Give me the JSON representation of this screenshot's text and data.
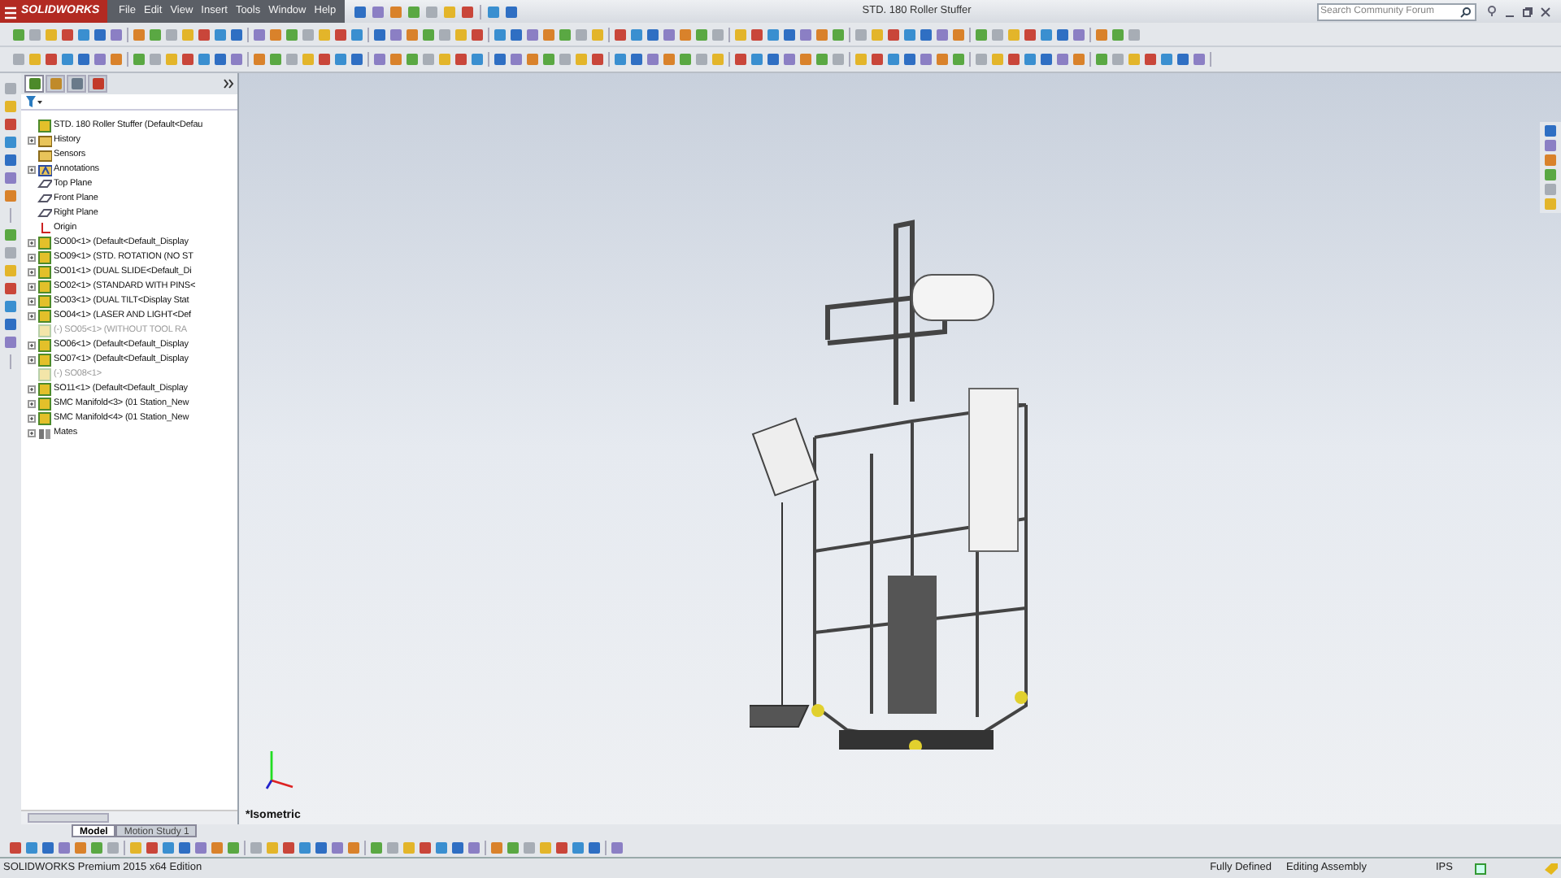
{
  "title_bar": {
    "logo": "SOLIDWORKS",
    "menus": [
      "File",
      "Edit",
      "View",
      "Insert",
      "Tools",
      "Window",
      "Help"
    ],
    "document_title": "STD. 180 Roller Stuffer",
    "search": {
      "placeholder": "Search Community Forum"
    }
  },
  "feature_tree": {
    "tabs": [
      {
        "kind": "features",
        "selected": true
      },
      {
        "kind": "properties",
        "selected": false
      },
      {
        "kind": "config",
        "selected": false
      },
      {
        "kind": "display",
        "selected": false
      }
    ],
    "items": [
      {
        "kind": "assembly",
        "label": "STD. 180 Roller Stuffer  (Default<Defau",
        "expandable": false,
        "suppressed": false
      },
      {
        "kind": "history",
        "label": "History",
        "expandable": true,
        "suppressed": false
      },
      {
        "kind": "folder",
        "label": "Sensors",
        "expandable": false,
        "suppressed": false
      },
      {
        "kind": "annotation",
        "label": "Annotations",
        "expandable": true,
        "suppressed": false
      },
      {
        "kind": "plane",
        "label": "Top Plane",
        "expandable": false,
        "suppressed": false
      },
      {
        "kind": "plane",
        "label": "Front Plane",
        "expandable": false,
        "suppressed": false
      },
      {
        "kind": "plane",
        "label": "Right Plane",
        "expandable": false,
        "suppressed": false
      },
      {
        "kind": "origin",
        "label": "Origin",
        "expandable": false,
        "suppressed": false
      },
      {
        "kind": "part",
        "label": "SO00<1> (Default<Default_Display",
        "expandable": true,
        "suppressed": false
      },
      {
        "kind": "part",
        "label": "SO09<1> (STD. ROTATION (NO ST",
        "expandable": true,
        "suppressed": false
      },
      {
        "kind": "part",
        "label": "SO01<1> (DUAL SLIDE<Default_Di",
        "expandable": true,
        "suppressed": false
      },
      {
        "kind": "part",
        "label": "SO02<1> (STANDARD WITH PINS<",
        "expandable": true,
        "suppressed": false
      },
      {
        "kind": "part",
        "label": "SO03<1> (DUAL TILT<Display Stat",
        "expandable": true,
        "suppressed": false
      },
      {
        "kind": "part",
        "label": "SO04<1> (LASER AND LIGHT<Def",
        "expandable": true,
        "suppressed": false
      },
      {
        "kind": "part",
        "label": "(-) SO05<1> (WITHOUT TOOL RA",
        "expandable": false,
        "suppressed": true
      },
      {
        "kind": "part",
        "label": "SO06<1> (Default<Default_Display",
        "expandable": true,
        "suppressed": false
      },
      {
        "kind": "part",
        "label": "SO07<1> (Default<Default_Display",
        "expandable": true,
        "suppressed": false
      },
      {
        "kind": "part",
        "label": "(-) SO08<1>",
        "expandable": false,
        "suppressed": true
      },
      {
        "kind": "part",
        "label": "SO11<1> (Default<Default_Display",
        "expandable": true,
        "suppressed": false
      },
      {
        "kind": "part",
        "label": "SMC Manifold<3> (01 Station_New",
        "expandable": true,
        "suppressed": false
      },
      {
        "kind": "part",
        "label": "SMC Manifold<4> (01 Station_New",
        "expandable": true,
        "suppressed": false
      },
      {
        "kind": "mates",
        "label": "Mates",
        "expandable": true,
        "suppressed": false
      }
    ]
  },
  "viewport": {
    "view_label": "*Isometric"
  },
  "bottom_tabs": [
    {
      "label": "Model",
      "selected": true
    },
    {
      "label": "Motion Study 1",
      "selected": false
    }
  ],
  "status_bar": {
    "edition": "SOLIDWORKS Premium 2015 x64 Edition",
    "state": "Fully Defined",
    "mode": "Editing Assembly",
    "units": "IPS"
  }
}
